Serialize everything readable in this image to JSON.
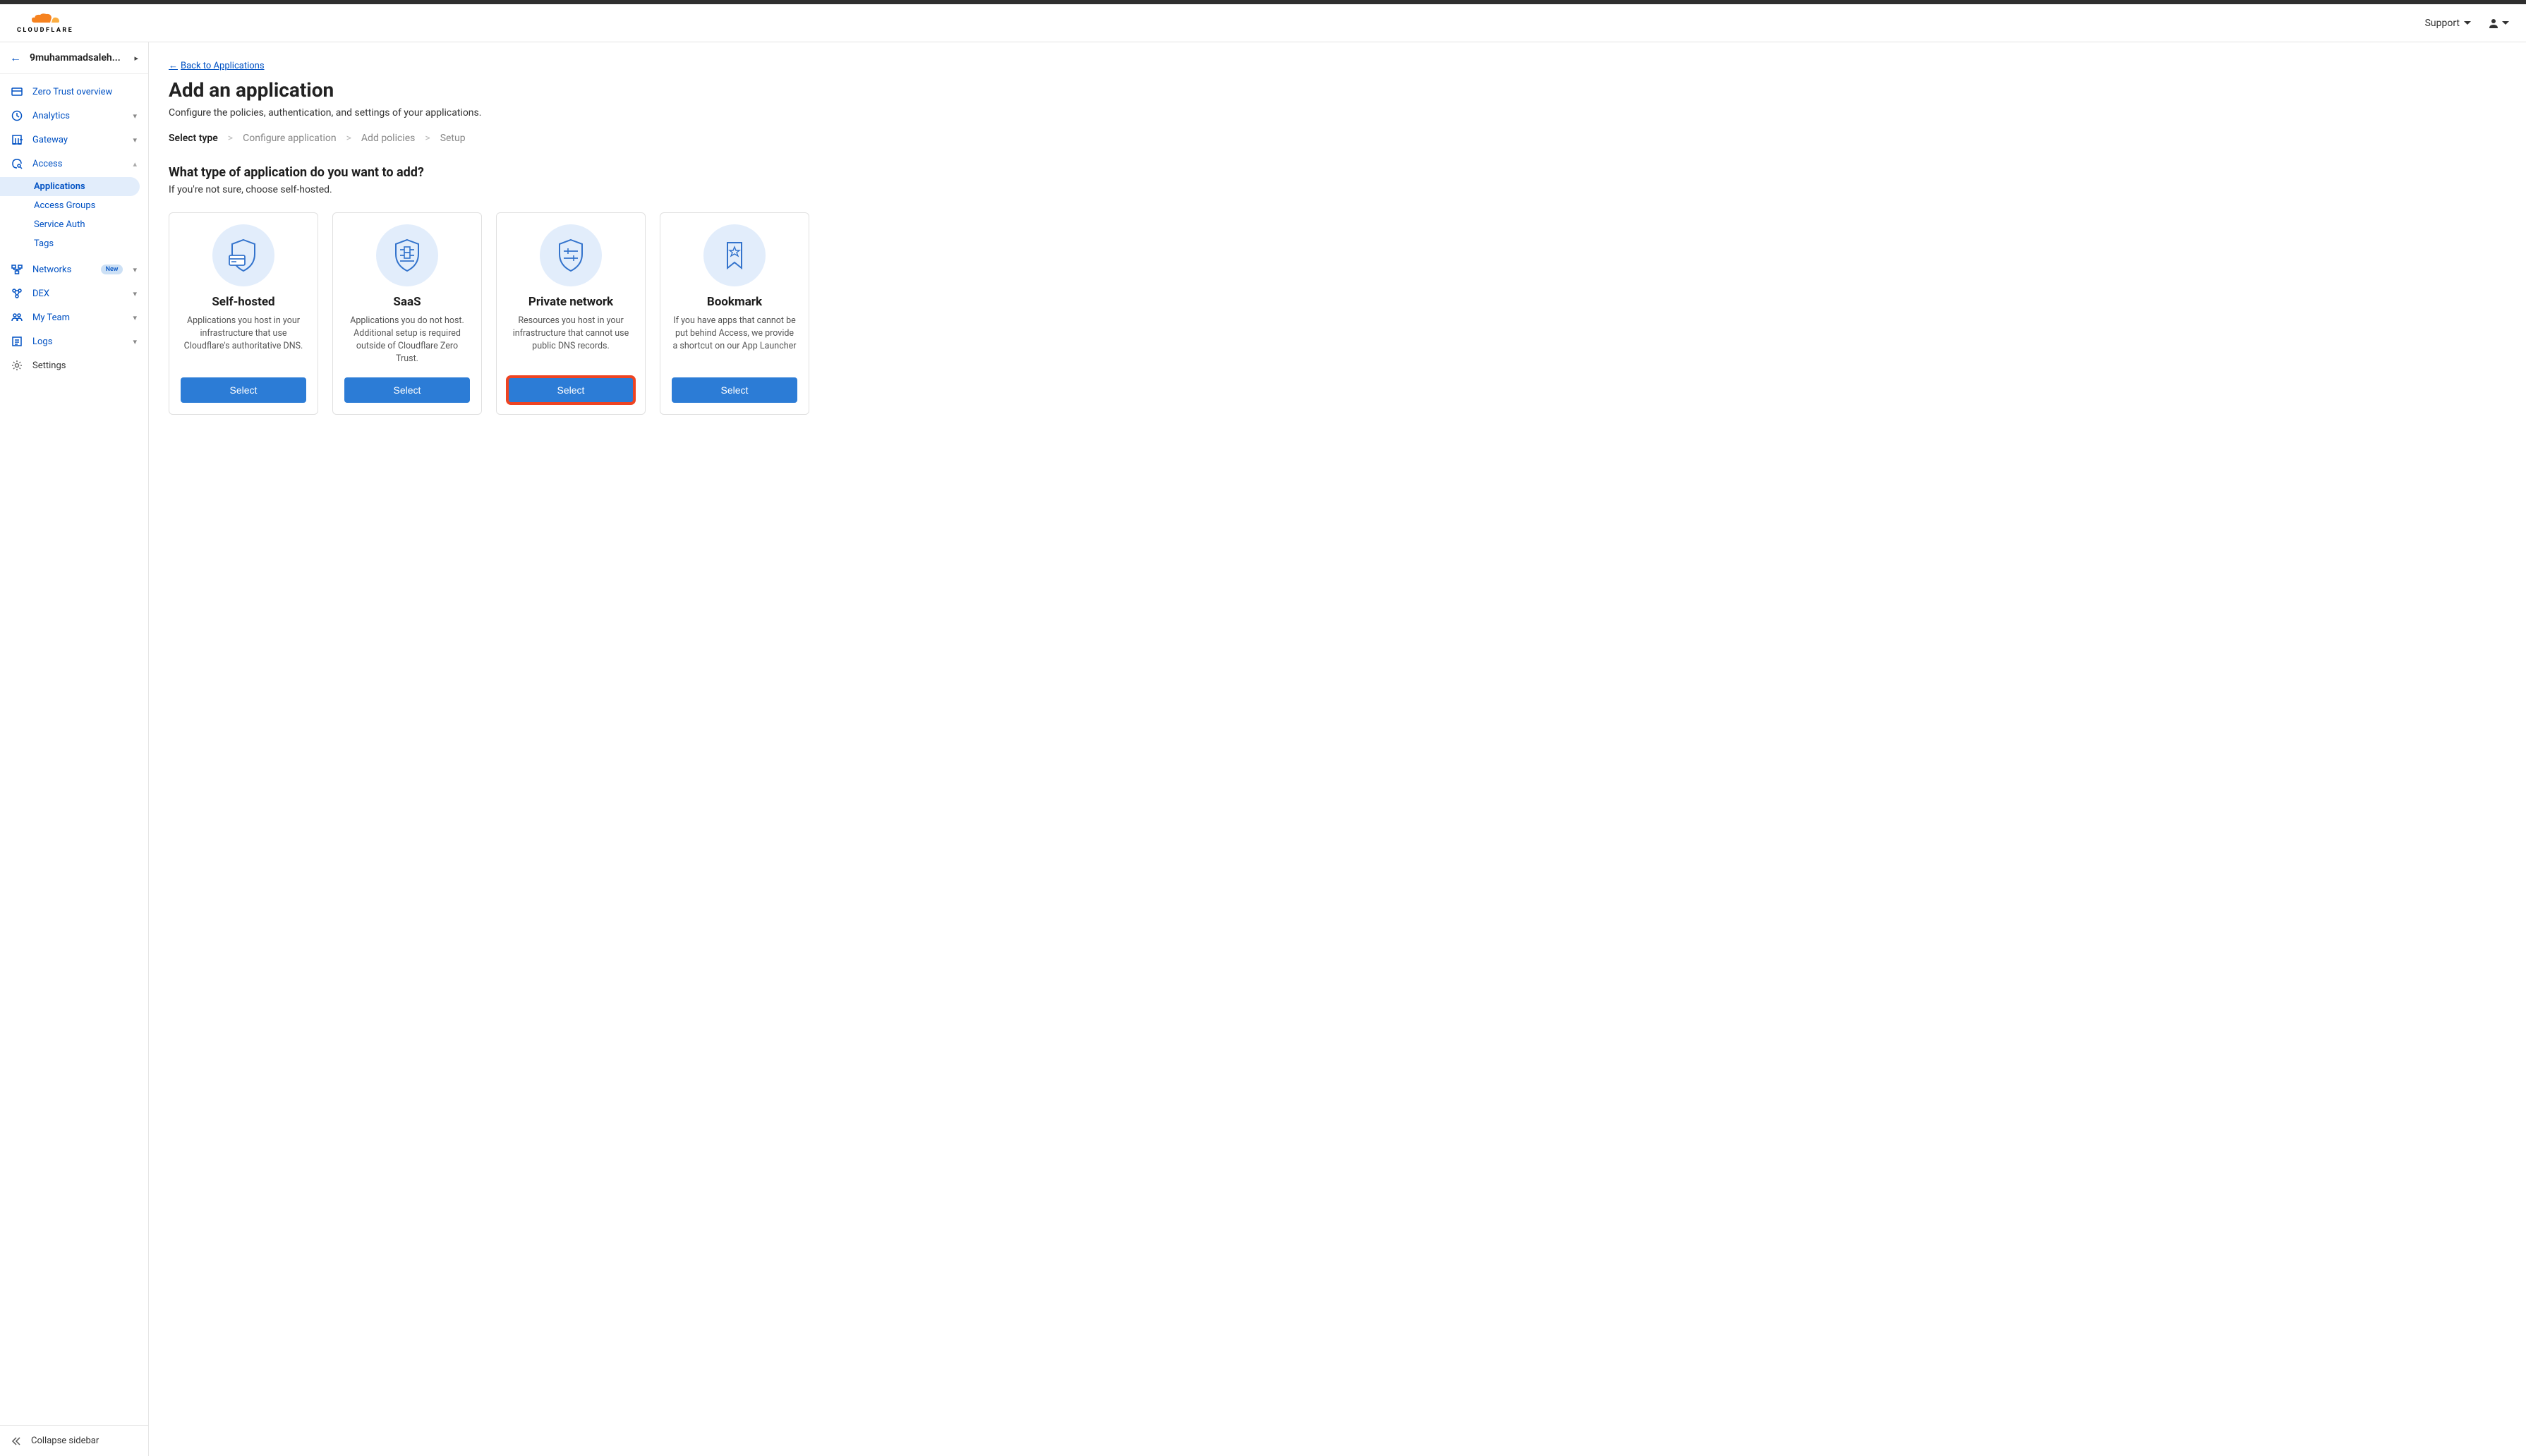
{
  "header": {
    "logo_text": "CLOUDFLARE",
    "support_label": "Support"
  },
  "sidebar": {
    "account_name": "9muhammadsaleh...",
    "items": [
      {
        "label": "Zero Trust overview",
        "icon": "card"
      },
      {
        "label": "Analytics",
        "icon": "clock",
        "expandable": true
      },
      {
        "label": "Gateway",
        "icon": "doorway",
        "expandable": true
      },
      {
        "label": "Access",
        "icon": "key-swirl",
        "expanded": true
      },
      {
        "label": "Networks",
        "icon": "network",
        "expandable": true,
        "badge": "New"
      },
      {
        "label": "DEX",
        "icon": "nodes",
        "expandable": true
      },
      {
        "label": "My Team",
        "icon": "people",
        "expandable": true
      },
      {
        "label": "Logs",
        "icon": "list",
        "expandable": true
      },
      {
        "label": "Settings",
        "icon": "gear"
      }
    ],
    "access_sub": [
      {
        "label": "Applications",
        "active": true
      },
      {
        "label": "Access Groups"
      },
      {
        "label": "Service Auth"
      },
      {
        "label": "Tags"
      }
    ],
    "collapse_label": "Collapse sidebar"
  },
  "main": {
    "back_link": "Back to Applications",
    "title": "Add an application",
    "subtitle": "Configure the policies, authentication, and settings of your applications.",
    "steps": [
      "Select type",
      "Configure application",
      "Add policies",
      "Setup"
    ],
    "section_heading": "What type of application do you want to add?",
    "section_hint": "If you're not sure, choose self-hosted.",
    "cards": [
      {
        "title": "Self-hosted",
        "desc": "Applications you host in your infrastructure that use Cloudflare's authoritative DNS.",
        "button": "Select"
      },
      {
        "title": "SaaS",
        "desc": "Applications you do not host. Additional setup is required outside of Cloudflare Zero Trust.",
        "button": "Select"
      },
      {
        "title": "Private network",
        "desc": "Resources you host in your infrastructure that cannot use public DNS records.",
        "button": "Select",
        "highlighted": true
      },
      {
        "title": "Bookmark",
        "desc": "If you have apps that cannot be put behind Access, we provide a shortcut on our App Launcher",
        "button": "Select"
      }
    ]
  }
}
